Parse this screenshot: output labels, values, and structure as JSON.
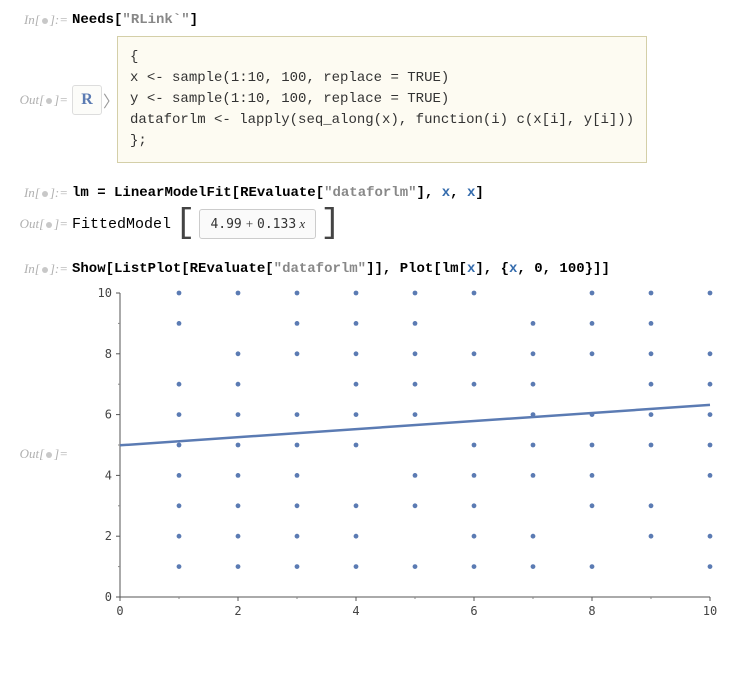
{
  "labels": {
    "in": "In[",
    "out": "Out[",
    "in_suffix": "]:=",
    "out_suffix": "]="
  },
  "cell1": {
    "needs": "Needs",
    "bracket_open": "[",
    "str": "\"RLink`\"",
    "bracket_close": "]"
  },
  "r_output": {
    "icon_text": "R",
    "chevron": "〉",
    "code": "{\nx <- sample(1:10, 100, replace = TRUE)\ny <- sample(1:10, 100, replace = TRUE)\ndataforlm <- lapply(seq_along(x), function(i) c(x[i], y[i]))\n};"
  },
  "cell2": {
    "lhs": "lm",
    "eq": " = ",
    "fn": "LinearModelFit",
    "open": "[",
    "rev": "REvaluate",
    "ropen": "[",
    "rstr": "\"dataforlm\"",
    "rclose": "]",
    "c1": ", ",
    "x1": "x",
    "c2": ", ",
    "x2": "x",
    "close": "]"
  },
  "fitted": {
    "label": "FittedModel",
    "expr_a": "4.99",
    "expr_plus": " + ",
    "expr_b": "0.133",
    "expr_x": " x"
  },
  "cell3": {
    "show": "Show",
    "o1": "[",
    "lp": "ListPlot",
    "o2": "[",
    "rev": "REvaluate",
    "o3": "[",
    "rstr": "\"dataforlm\"",
    "c3": "]",
    "c2": "]",
    "com1": ", ",
    "plot": "Plot",
    "o4": "[",
    "lm": "lm",
    "o5": "[",
    "x": "x",
    "c5": "]",
    "com2": ", ",
    "brace_o": "{",
    "px": "x",
    "com3": ", ",
    "n0": "0",
    "com4": ", ",
    "n100": "100",
    "brace_c": "}",
    "c4": "]",
    "c1": "]"
  },
  "chart_data": {
    "type": "scatter",
    "title": "",
    "xlabel": "",
    "ylabel": "",
    "xlim": [
      0,
      10
    ],
    "ylim": [
      0,
      10
    ],
    "xticks": [
      0,
      2,
      4,
      6,
      8,
      10
    ],
    "yticks": [
      0,
      2,
      4,
      6,
      8,
      10
    ],
    "series": [
      {
        "name": "dataforlm",
        "type": "scatter",
        "points": [
          [
            1,
            1
          ],
          [
            1,
            2
          ],
          [
            1,
            3
          ],
          [
            1,
            4
          ],
          [
            1,
            5
          ],
          [
            1,
            6
          ],
          [
            1,
            7
          ],
          [
            1,
            9
          ],
          [
            1,
            10
          ],
          [
            2,
            1
          ],
          [
            2,
            2
          ],
          [
            2,
            3
          ],
          [
            2,
            4
          ],
          [
            2,
            5
          ],
          [
            2,
            6
          ],
          [
            2,
            7
          ],
          [
            2,
            8
          ],
          [
            2,
            10
          ],
          [
            3,
            1
          ],
          [
            3,
            2
          ],
          [
            3,
            3
          ],
          [
            3,
            4
          ],
          [
            3,
            5
          ],
          [
            3,
            6
          ],
          [
            3,
            8
          ],
          [
            3,
            9
          ],
          [
            3,
            10
          ],
          [
            4,
            1
          ],
          [
            4,
            2
          ],
          [
            4,
            3
          ],
          [
            4,
            5
          ],
          [
            4,
            6
          ],
          [
            4,
            7
          ],
          [
            4,
            8
          ],
          [
            4,
            9
          ],
          [
            4,
            10
          ],
          [
            5,
            1
          ],
          [
            5,
            3
          ],
          [
            5,
            4
          ],
          [
            5,
            6
          ],
          [
            5,
            7
          ],
          [
            5,
            8
          ],
          [
            5,
            9
          ],
          [
            5,
            10
          ],
          [
            6,
            1
          ],
          [
            6,
            2
          ],
          [
            6,
            3
          ],
          [
            6,
            4
          ],
          [
            6,
            5
          ],
          [
            6,
            7
          ],
          [
            6,
            8
          ],
          [
            6,
            10
          ],
          [
            7,
            1
          ],
          [
            7,
            2
          ],
          [
            7,
            4
          ],
          [
            7,
            5
          ],
          [
            7,
            6
          ],
          [
            7,
            7
          ],
          [
            7,
            8
          ],
          [
            7,
            9
          ],
          [
            8,
            1
          ],
          [
            8,
            3
          ],
          [
            8,
            4
          ],
          [
            8,
            5
          ],
          [
            8,
            6
          ],
          [
            8,
            8
          ],
          [
            8,
            9
          ],
          [
            8,
            10
          ],
          [
            9,
            2
          ],
          [
            9,
            3
          ],
          [
            9,
            5
          ],
          [
            9,
            6
          ],
          [
            9,
            7
          ],
          [
            9,
            8
          ],
          [
            9,
            9
          ],
          [
            9,
            10
          ],
          [
            10,
            1
          ],
          [
            10,
            2
          ],
          [
            10,
            4
          ],
          [
            10,
            5
          ],
          [
            10,
            6
          ],
          [
            10,
            7
          ],
          [
            10,
            8
          ],
          [
            10,
            10
          ]
        ]
      },
      {
        "name": "lm[x]",
        "type": "line",
        "equation": "4.99 + 0.133*x",
        "x0": 0,
        "y0": 4.99,
        "x1": 10,
        "y1": 6.32
      }
    ]
  }
}
